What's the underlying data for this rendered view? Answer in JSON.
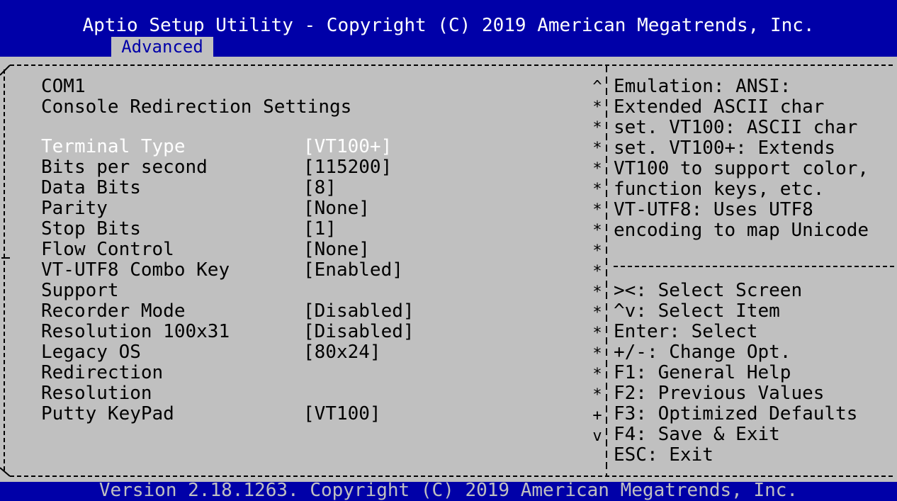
{
  "header": {
    "title": "Aptio Setup Utility - Copyright (C) 2019 American Megatrends, Inc.",
    "tabs": [
      {
        "label": "Advanced",
        "active": true
      }
    ]
  },
  "left_panel": {
    "port": "COM1",
    "section_title": "Console Redirection Settings",
    "items": [
      {
        "label": "Terminal Type",
        "value": "[VT100+]",
        "selected": true
      },
      {
        "label": "Bits per second",
        "value": "[115200]"
      },
      {
        "label": "Data Bits",
        "value": "[8]"
      },
      {
        "label": "Parity",
        "value": "[None]"
      },
      {
        "label": "Stop Bits",
        "value": "[1]"
      },
      {
        "label": "Flow Control",
        "value": "[None]"
      },
      {
        "label": "VT-UTF8 Combo Key",
        "value": "[Enabled]"
      },
      {
        "label": "Support",
        "value": ""
      },
      {
        "label": "Recorder Mode",
        "value": "[Disabled]"
      },
      {
        "label": "Resolution 100x31",
        "value": "[Disabled]"
      },
      {
        "label": "Legacy OS",
        "value": "[80x24]"
      },
      {
        "label": "Redirection",
        "value": ""
      },
      {
        "label": "Resolution",
        "value": ""
      },
      {
        "label": "Putty KeyPad",
        "value": "[VT100]"
      }
    ]
  },
  "help_panel": {
    "help_lines": [
      "Emulation: ANSI:",
      "Extended ASCII char",
      "set. VT100: ASCII char",
      "set. VT100+: Extends",
      "VT100 to support color,",
      "function keys, etc.",
      "VT-UTF8: Uses UTF8",
      "encoding to map Unicode"
    ],
    "key_legend": [
      "><: Select Screen",
      "^v: Select Item",
      "Enter: Select",
      "+/-: Change Opt.",
      "F1: General Help",
      "F2: Previous Values",
      "F3: Optimized Defaults",
      "F4: Save & Exit",
      "ESC: Exit"
    ]
  },
  "scrollbar": {
    "chars": [
      "^",
      "*",
      "*",
      "*",
      "*",
      "*",
      "*",
      "*",
      "*",
      "*",
      "*",
      "*",
      "*",
      "*",
      "*",
      "*",
      "+",
      "v"
    ]
  },
  "footer": {
    "text": "Version 2.18.1263. Copyright (C) 2019 American Megatrends, Inc."
  },
  "colors": {
    "background_blue": "#0000a8",
    "panel_gray": "#c0c0c0",
    "text_black": "#000000",
    "selected_white": "#ffffff"
  }
}
